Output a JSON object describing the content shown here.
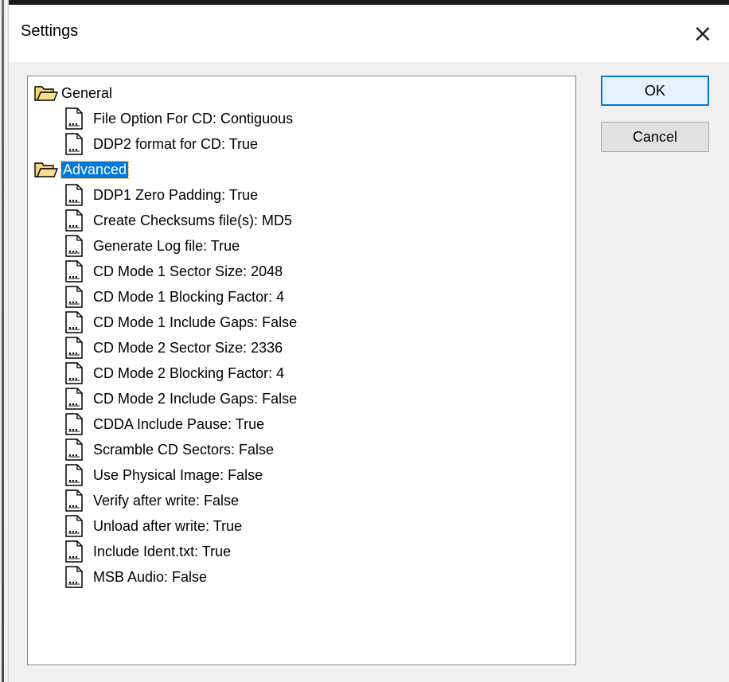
{
  "window": {
    "title": "Settings",
    "close_glyph": "×"
  },
  "buttons": {
    "ok": "OK",
    "cancel": "Cancel"
  },
  "tree": {
    "general": {
      "label": "General",
      "icon": "folder-open-icon",
      "items": [
        "File Option For CD: Contiguous",
        "DDP2 format for CD: True"
      ]
    },
    "advanced": {
      "label": "Advanced",
      "icon": "folder-open-icon",
      "selected": true,
      "items": [
        "DDP1 Zero Padding: True",
        "Create Checksums file(s): MD5",
        "Generate Log file: True",
        "CD Mode 1 Sector Size: 2048",
        "CD Mode 1 Blocking Factor: 4",
        "CD Mode 1 Include Gaps: False",
        "CD Mode 2 Sector Size: 2336",
        "CD Mode 2 Blocking Factor: 4",
        "CD Mode 2 Include Gaps: False",
        "CDDA Include Pause: True",
        "Scramble CD Sectors: False",
        "Use Physical Image: False",
        "Verify after write: False",
        "Unload after write: True",
        "Include Ident.txt: True",
        "MSB Audio: False"
      ]
    }
  },
  "colors": {
    "selection": "#0078d7",
    "default_button_border": "#0078d7"
  }
}
